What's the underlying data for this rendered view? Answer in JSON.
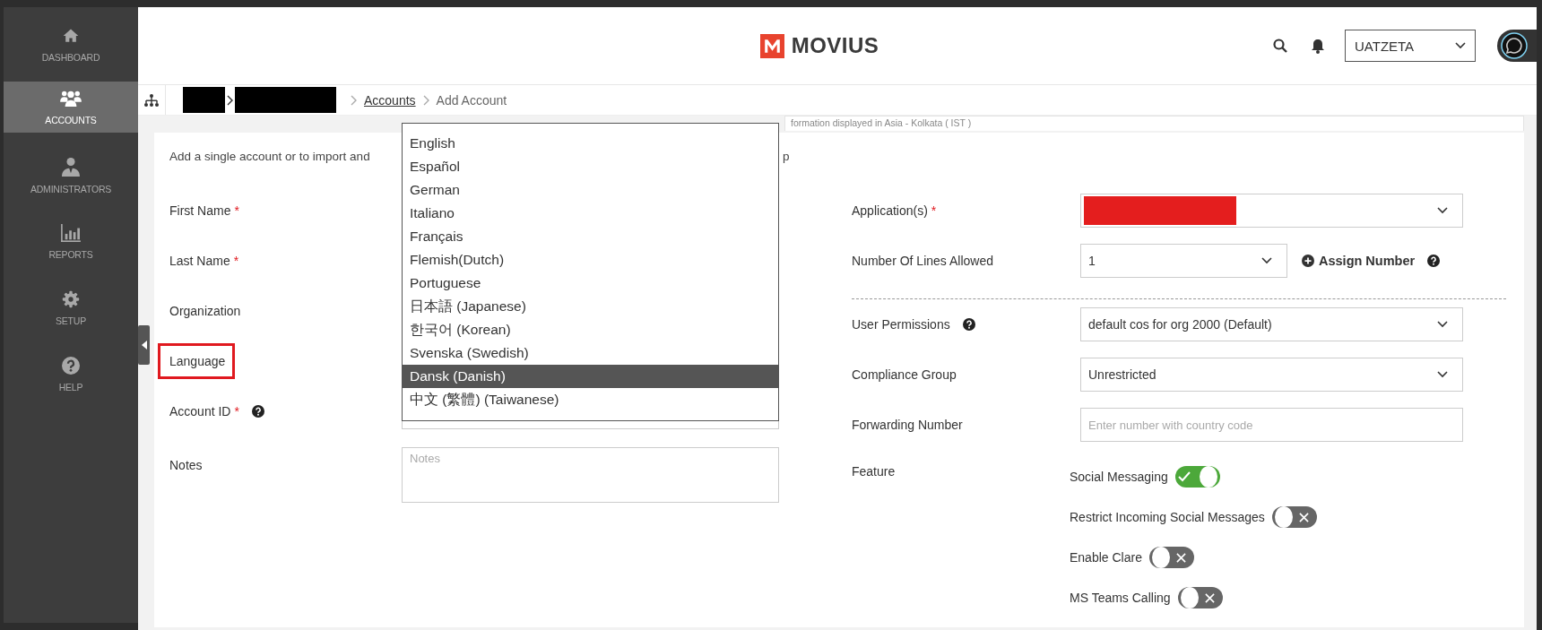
{
  "sidebar": {
    "items": [
      {
        "label": "DASHBOARD",
        "selected": false
      },
      {
        "label": "ACCOUNTS",
        "selected": true
      },
      {
        "label": "ADMINISTRATORS",
        "selected": false
      },
      {
        "label": "REPORTS",
        "selected": false
      },
      {
        "label": "SETUP",
        "selected": false
      },
      {
        "label": "HELP",
        "selected": false
      }
    ]
  },
  "header": {
    "logo": "MOVIUS",
    "org_select": "UATZETA"
  },
  "breadcrumb": {
    "link": "Accounts",
    "current": "Add Account"
  },
  "timezone_note": "formation displayed in Asia - Kolkata ( IST )",
  "intro": {
    "start": "Add a single account or to import and",
    "end": "p"
  },
  "left_form": {
    "fields": [
      {
        "label": "First Name",
        "required_mark": "*",
        "highlighted": false
      },
      {
        "label": "Last Name",
        "required_mark": "*",
        "highlighted": false
      },
      {
        "label": "Organization",
        "highlighted": false
      },
      {
        "label": "Language",
        "highlighted": true
      },
      {
        "label": "Account ID",
        "required_mark": "*",
        "help": true,
        "highlighted": false,
        "kind": "input"
      },
      {
        "label": "Notes",
        "highlighted": false,
        "kind": "textarea",
        "placeholder": "Notes"
      }
    ]
  },
  "language_dropdown": {
    "options": [
      {
        "label": "English",
        "selected": false
      },
      {
        "label": "Español",
        "selected": false
      },
      {
        "label": "German",
        "selected": false
      },
      {
        "label": "Italiano",
        "selected": false
      },
      {
        "label": "Français",
        "selected": false
      },
      {
        "label": "Flemish(Dutch)",
        "selected": false
      },
      {
        "label": "Portuguese",
        "selected": false
      },
      {
        "label": "日本語 (Japanese)",
        "selected": false
      },
      {
        "label": "한국어 (Korean)",
        "selected": false
      },
      {
        "label": "Svenska (Swedish)",
        "selected": false
      },
      {
        "label": "Dansk (Danish)",
        "selected": true
      },
      {
        "label": "中文 (繁體) (Taiwanese)",
        "selected": false
      }
    ]
  },
  "right_form": {
    "fields": [
      {
        "label": "Application(s)",
        "required_mark": "*",
        "kind": "redacted-select"
      },
      {
        "label": "Number Of Lines Allowed",
        "kind": "select",
        "value": "1",
        "action": "Assign Number"
      },
      {
        "label": "User Permissions",
        "help": true,
        "kind": "select",
        "value": "default cos for org 2000 (Default)"
      },
      {
        "label": "Compliance Group",
        "kind": "select",
        "value": "Unrestricted"
      },
      {
        "label": "Forwarding Number",
        "kind": "input",
        "placeholder": "Enter number with country code"
      }
    ]
  },
  "features": {
    "label": "Feature",
    "items": [
      {
        "label": "Social Messaging",
        "on": true
      },
      {
        "label": "Restrict Incoming Social Messages",
        "on": false
      },
      {
        "label": "Enable Clare",
        "on": false
      },
      {
        "label": "MS Teams Calling",
        "on": false
      }
    ]
  }
}
